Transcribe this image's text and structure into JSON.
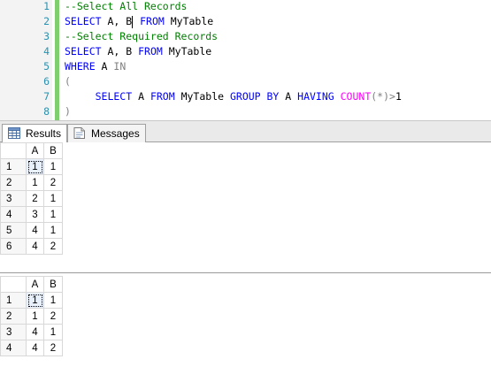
{
  "editor": {
    "lines": [
      {
        "num": "1",
        "tokens": [
          {
            "t": "--Select All Records",
            "c": "cm"
          }
        ]
      },
      {
        "num": "2",
        "tokens": [
          {
            "t": "SELECT",
            "c": "kw"
          },
          {
            "t": " A, B",
            "c": "tx"
          },
          {
            "caret": true
          },
          {
            "t": " FROM",
            "c": "kw"
          },
          {
            "t": " MyTable",
            "c": "tx"
          }
        ]
      },
      {
        "num": "3",
        "tokens": [
          {
            "t": "--Select Required Records",
            "c": "cm"
          }
        ]
      },
      {
        "num": "4",
        "tokens": [
          {
            "t": "SELECT",
            "c": "kw"
          },
          {
            "t": " A, B ",
            "c": "tx"
          },
          {
            "t": "FROM",
            "c": "kw"
          },
          {
            "t": " MyTable",
            "c": "tx"
          }
        ]
      },
      {
        "num": "5",
        "tokens": [
          {
            "t": "WHERE",
            "c": "kw"
          },
          {
            "t": " A ",
            "c": "tx"
          },
          {
            "t": "IN",
            "c": "gr"
          }
        ]
      },
      {
        "num": "6",
        "tokens": [
          {
            "t": "(",
            "c": "gr"
          }
        ]
      },
      {
        "num": "7",
        "tokens": [
          {
            "t": "     SELECT",
            "c": "kw"
          },
          {
            "t": " A ",
            "c": "tx"
          },
          {
            "t": "FROM",
            "c": "kw"
          },
          {
            "t": " MyTable ",
            "c": "tx"
          },
          {
            "t": "GROUP BY",
            "c": "kw"
          },
          {
            "t": " A ",
            "c": "tx"
          },
          {
            "t": "HAVING",
            "c": "kw"
          },
          {
            "t": " ",
            "c": "tx"
          },
          {
            "t": "COUNT",
            "c": "fn"
          },
          {
            "t": "(*)>",
            "c": "gr"
          },
          {
            "t": "1",
            "c": "tx"
          }
        ]
      },
      {
        "num": "8",
        "tokens": [
          {
            "t": ")",
            "c": "gr"
          }
        ]
      }
    ]
  },
  "tabs": [
    {
      "label": "Results",
      "icon": "grid-icon",
      "active": true
    },
    {
      "label": "Messages",
      "icon": "messages-icon",
      "active": false
    }
  ],
  "grids": [
    {
      "columns": [
        "A",
        "B"
      ],
      "rows": [
        {
          "n": "1",
          "cells": [
            "1",
            "1"
          ]
        },
        {
          "n": "2",
          "cells": [
            "1",
            "2"
          ]
        },
        {
          "n": "3",
          "cells": [
            "2",
            "1"
          ]
        },
        {
          "n": "4",
          "cells": [
            "3",
            "1"
          ]
        },
        {
          "n": "5",
          "cells": [
            "4",
            "1"
          ]
        },
        {
          "n": "6",
          "cells": [
            "4",
            "2"
          ]
        }
      ]
    },
    {
      "columns": [
        "A",
        "B"
      ],
      "rows": [
        {
          "n": "1",
          "cells": [
            "1",
            "1"
          ]
        },
        {
          "n": "2",
          "cells": [
            "1",
            "2"
          ]
        },
        {
          "n": "3",
          "cells": [
            "4",
            "1"
          ]
        },
        {
          "n": "4",
          "cells": [
            "4",
            "2"
          ]
        }
      ]
    }
  ],
  "colors": {
    "line_number": "#2b91af",
    "keyword": "#0000ff",
    "comment": "#008000",
    "function": "#ff00ff",
    "operator": "#808080",
    "change_bar": "#7fcf6f"
  }
}
